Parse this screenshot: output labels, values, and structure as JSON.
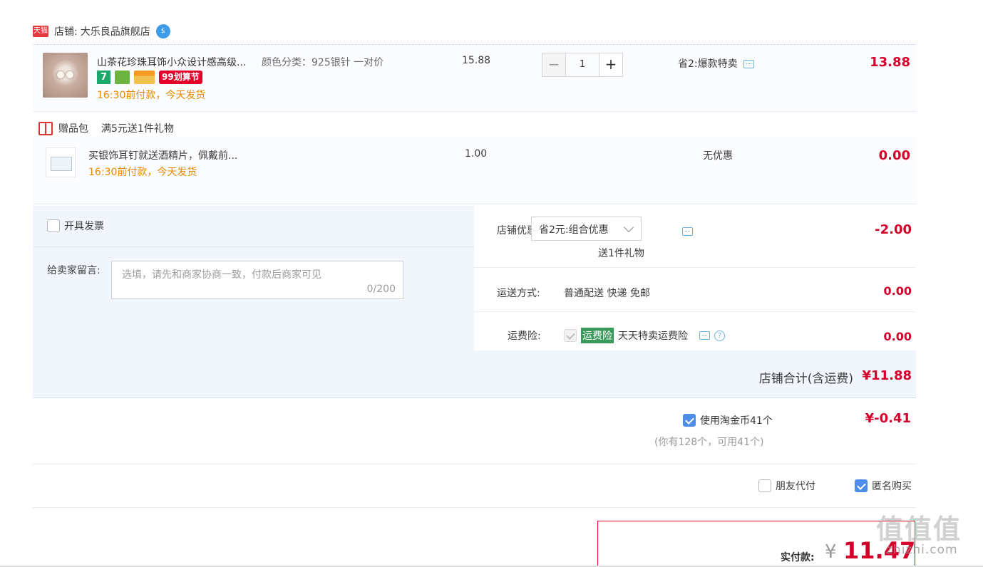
{
  "shop": {
    "platform_badge": "天猫",
    "label": "店铺:",
    "name": "大乐良品旗舰店",
    "chat_icon_label": "$"
  },
  "item": {
    "title": "山茶花珍珠耳饰小众设计感高级...",
    "spec": "颜色分类：925银针 一对价",
    "badge_7": "7",
    "badge_99": "99划算节",
    "ship_note": "16:30前付款，今天发货",
    "unit_price": "15.88",
    "qty_minus": "−",
    "qty": "1",
    "qty_plus": "+",
    "promo": "省2:爆款特卖",
    "subtotal": "13.88"
  },
  "gift": {
    "label": "赠品包",
    "rule": "满5元送1件礼物",
    "title": "买银饰耳钉就送酒精片，佩戴前...",
    "ship_note": "16:30前付款，今天发货",
    "unit_price": "1.00",
    "promo": "无优惠",
    "subtotal": "0.00"
  },
  "order_options": {
    "invoice_label": "开具发票",
    "message_label": "给卖家留言:",
    "message_placeholder": "选填，请先和商家协商一致，付款后商家可见",
    "message_count": "0/200",
    "shop_discount_label": "店铺优惠:",
    "shop_discount_selected": "省2元:组合优惠",
    "shop_discount_gift": "送1件礼物",
    "shop_discount_amount": "-2.00",
    "delivery_label": "运送方式:",
    "delivery_value": "普通配送 快递 免邮",
    "delivery_amount": "0.00",
    "insurance_label": "运费险:",
    "insurance_tag": "运费险",
    "insurance_desc": "天天特卖运费险",
    "insurance_help": "?",
    "insurance_amount": "0.00",
    "shop_total_label": "店铺合计(含运费)",
    "shop_total": "¥11.88"
  },
  "coins": {
    "label": "使用淘金币41个",
    "amount": "¥-0.41",
    "note": "(你有128个，可用41个)"
  },
  "pay_options": {
    "friend_pay": "朋友代付",
    "anonymous": "匿名购买"
  },
  "payment": {
    "label": "实付款:",
    "currency": "¥",
    "amount": "11.47"
  },
  "watermark": {
    "glyphs": "值值值",
    "site": "zhizhi.com"
  },
  "colors": {
    "price_red": "#d4002a",
    "ship_orange": "#e68a00",
    "check_blue": "#4b8de8",
    "insurance_green": "#3a9a5a"
  }
}
